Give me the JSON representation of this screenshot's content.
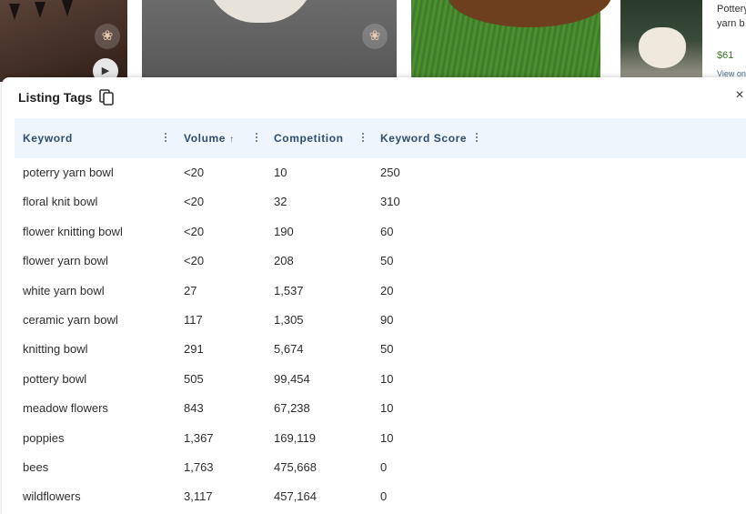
{
  "background": {
    "side_card": {
      "title_line1": "Pottery",
      "title_line2": "yarn b",
      "price": "$61",
      "view": "View on"
    },
    "play_icon": "play-icon",
    "favorite_icon": "heart-icon"
  },
  "modal": {
    "title": "Listing Tags",
    "copy_icon": "copy-icon",
    "close_icon": "close-icon",
    "close_label": "×"
  },
  "table": {
    "columns": [
      {
        "label": "Keyword",
        "sort": ""
      },
      {
        "label": "Volume",
        "sort": "↑"
      },
      {
        "label": "Competition",
        "sort": ""
      },
      {
        "label": "Keyword Score",
        "sort": ""
      }
    ],
    "rows": [
      {
        "keyword": "poterry yarn bowl",
        "volume": "<20",
        "competition": "10",
        "score": "250"
      },
      {
        "keyword": "floral knit bowl",
        "volume": "<20",
        "competition": "32",
        "score": "310"
      },
      {
        "keyword": "flower knitting bowl",
        "volume": "<20",
        "competition": "190",
        "score": "60"
      },
      {
        "keyword": "flower yarn bowl",
        "volume": "<20",
        "competition": "208",
        "score": "50"
      },
      {
        "keyword": "white yarn bowl",
        "volume": "27",
        "competition": "1,537",
        "score": "20"
      },
      {
        "keyword": "ceramic yarn bowl",
        "volume": "117",
        "competition": "1,305",
        "score": "90"
      },
      {
        "keyword": "knitting bowl",
        "volume": "291",
        "competition": "5,674",
        "score": "50"
      },
      {
        "keyword": "pottery bowl",
        "volume": "505",
        "competition": "99,454",
        "score": "10"
      },
      {
        "keyword": "meadow flowers",
        "volume": "843",
        "competition": "67,238",
        "score": "10"
      },
      {
        "keyword": "poppies",
        "volume": "1,367",
        "competition": "169,119",
        "score": "10"
      },
      {
        "keyword": "bees",
        "volume": "1,763",
        "competition": "475,668",
        "score": "0"
      },
      {
        "keyword": "wildflowers",
        "volume": "3,117",
        "competition": "457,164",
        "score": "0"
      }
    ]
  }
}
